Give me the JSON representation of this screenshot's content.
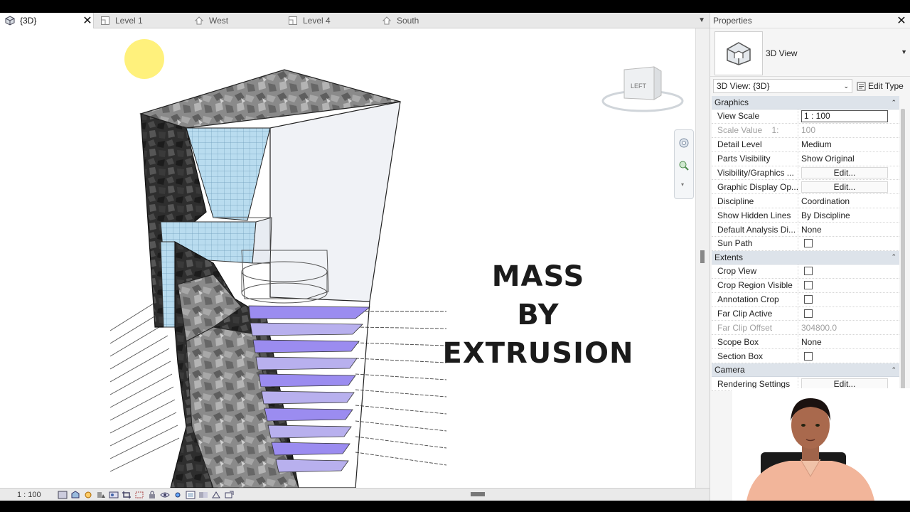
{
  "tabs": [
    {
      "label": "{3D}",
      "icon": "3d-view-icon",
      "active": true
    },
    {
      "label": "Level 1",
      "icon": "floor-plan-icon",
      "active": false
    },
    {
      "label": "West",
      "icon": "elevation-icon",
      "active": false
    },
    {
      "label": "Level 4",
      "icon": "floor-plan-icon",
      "active": false
    },
    {
      "label": "South",
      "icon": "elevation-icon",
      "active": false
    }
  ],
  "viewcube": {
    "face_label": "LEFT"
  },
  "overlay": {
    "line1": "MASS",
    "line2": "BY EXTRUSION"
  },
  "status_bar": {
    "scale": "1 : 100"
  },
  "properties": {
    "title": "Properties",
    "type_name": "3D View",
    "instance_selector": "3D View: {3D}",
    "edit_type_label": "Edit Type",
    "groups": [
      {
        "name": "Graphics",
        "rows": [
          {
            "name": "View Scale",
            "value": "1 : 100",
            "kind": "input"
          },
          {
            "name": "Scale Value    1:",
            "value": "100",
            "kind": "text",
            "disabled": true
          },
          {
            "name": "Detail Level",
            "value": "Medium",
            "kind": "text"
          },
          {
            "name": "Parts Visibility",
            "value": "Show Original",
            "kind": "text"
          },
          {
            "name": "Visibility/Graphics ...",
            "value": "Edit...",
            "kind": "button"
          },
          {
            "name": "Graphic Display Op...",
            "value": "Edit...",
            "kind": "button"
          },
          {
            "name": "Discipline",
            "value": "Coordination",
            "kind": "text"
          },
          {
            "name": "Show Hidden Lines",
            "value": "By Discipline",
            "kind": "text"
          },
          {
            "name": "Default Analysis Di...",
            "value": "None",
            "kind": "text"
          },
          {
            "name": "Sun Path",
            "value": "",
            "kind": "checkbox"
          }
        ]
      },
      {
        "name": "Extents",
        "rows": [
          {
            "name": "Crop View",
            "value": "",
            "kind": "checkbox"
          },
          {
            "name": "Crop Region Visible",
            "value": "",
            "kind": "checkbox"
          },
          {
            "name": "Annotation Crop",
            "value": "",
            "kind": "checkbox"
          },
          {
            "name": "Far Clip Active",
            "value": "",
            "kind": "checkbox"
          },
          {
            "name": "Far Clip Offset",
            "value": "304800.0",
            "kind": "text",
            "disabled": true
          },
          {
            "name": "Scope Box",
            "value": "None",
            "kind": "text"
          },
          {
            "name": "Section Box",
            "value": "",
            "kind": "checkbox"
          }
        ]
      },
      {
        "name": "Camera",
        "rows": [
          {
            "name": "Rendering Settings",
            "value": "Edit...",
            "kind": "button"
          }
        ]
      }
    ]
  },
  "colors": {
    "accent_purple": "#9b8cf0",
    "curtain_wall_blue": "#b9dcef",
    "group_header": "#dde3ea",
    "cursor_highlight": "#ffec50"
  }
}
